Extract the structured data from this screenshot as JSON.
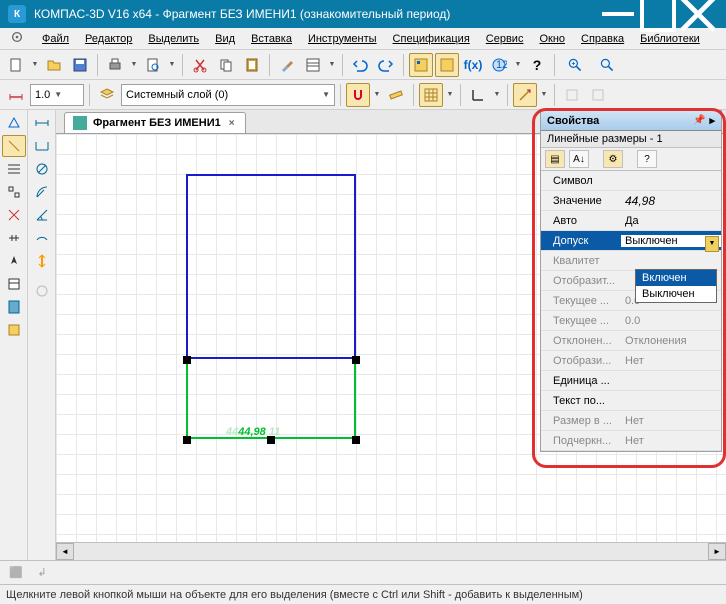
{
  "titlebar": {
    "app_icon": "К",
    "title": "КОМПАС-3D V16  x64 - Фрагмент БЕЗ ИМЕНИ1 (ознакомительный период)"
  },
  "menu": {
    "items": [
      "Файл",
      "Редактор",
      "Выделить",
      "Вид",
      "Вставка",
      "Инструменты",
      "Спецификация",
      "Сервис",
      "Окно",
      "Справка",
      "Библиотеки"
    ]
  },
  "toolbar2": {
    "scale_value": "1.0",
    "layer_label": "Системный слой (0)"
  },
  "doc_tab": {
    "label": "Фрагмент БЕЗ ИМЕНИ1",
    "close": "×"
  },
  "canvas": {
    "dim_value": "44,98"
  },
  "props": {
    "title": "Свойства",
    "subtitle": "Линейные размеры - 1",
    "rows": [
      {
        "label": "Символ",
        "value": ""
      },
      {
        "label": "Значение",
        "value": "44,98"
      },
      {
        "label": "Авто",
        "value": "Да"
      },
      {
        "label": "Допуск",
        "value": "Выключен"
      },
      {
        "label": "Квалитет",
        "value": ""
      },
      {
        "label": "Отобразит...",
        "value": ""
      },
      {
        "label": "Текущее ...",
        "value": "0.0"
      },
      {
        "label": "Текущее ...",
        "value": "0.0"
      },
      {
        "label": "Отклонен...",
        "value": "Отклонения"
      },
      {
        "label": "Отобрази...",
        "value": "Нет"
      },
      {
        "label": "Единица ...",
        "value": ""
      },
      {
        "label": "Текст по...",
        "value": ""
      },
      {
        "label": "Размер в ...",
        "value": "Нет"
      },
      {
        "label": "Подчеркн...",
        "value": "Нет"
      }
    ],
    "dropdown": {
      "opt_on": "Включен",
      "opt_off": "Выключен"
    }
  },
  "status": {
    "text": "Щелкните левой кнопкой мыши на объекте для его выделения (вместе с Ctrl или Shift - добавить к выделенным)"
  },
  "chart_data": null
}
